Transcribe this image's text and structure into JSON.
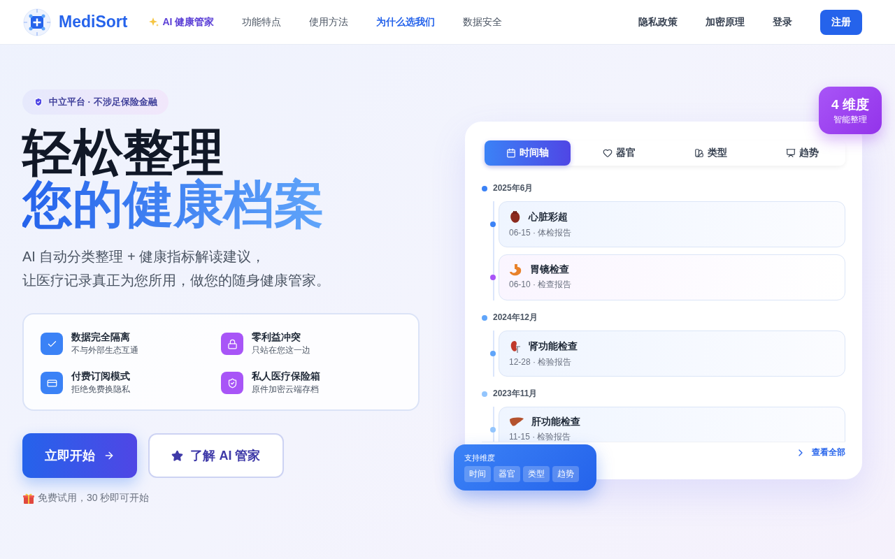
{
  "nav": {
    "brand": "MediSort",
    "links": [
      {
        "label": "AI 健康管家",
        "kind": "ai",
        "selected": false
      },
      {
        "label": "功能特点",
        "kind": "plain",
        "selected": false
      },
      {
        "label": "使用方法",
        "kind": "plain",
        "selected": false
      },
      {
        "label": "为什么选我们",
        "kind": "plain",
        "selected": true
      },
      {
        "label": "数据安全",
        "kind": "plain",
        "selected": false
      }
    ],
    "right_links": [
      "隐私政策",
      "加密原理",
      "登录"
    ],
    "signup": "注册"
  },
  "hero": {
    "badge": "中立平台 · 不涉足保险金融",
    "title_line_1": "轻松整理",
    "title_line_2": "您的健康档案",
    "subtitle_lines": [
      "AI 自动分类整理 + 健康指标解读建议，",
      "让医疗记录真正为您所用，做您的随身健康管家。"
    ],
    "features": [
      {
        "color": "#3b82f6",
        "title": "数据完全隔离",
        "text": "不与外部生态互通"
      },
      {
        "color": "#a855f7",
        "title": "零利益冲突",
        "text": "只站在您这一边"
      },
      {
        "color": "#3b82f6",
        "title": "付费订阅模式",
        "text": "拒绝免费换隐私"
      },
      {
        "color": "#a855f7",
        "title": "私人医疗保险箱",
        "text": "原件加密云端存档"
      }
    ],
    "primary_button": "立即开始",
    "secondary_button": "了解 AI 管家",
    "note": "免费试用，30 秒即可开始"
  },
  "preview": {
    "tabs": [
      {
        "label": "时间轴",
        "selected": true
      },
      {
        "label": "器官",
        "selected": false
      },
      {
        "label": "类型",
        "selected": false
      },
      {
        "label": "趋势",
        "selected": false
      }
    ],
    "corner_badge": {
      "value": "4 维度",
      "caption": "智能整理"
    },
    "groups": [
      {
        "month": "2025年6月",
        "color": "#3b82f6",
        "entries": [
          {
            "kind": "heart",
            "title": "心脏彩超",
            "meta": "06-15 · 体检报告",
            "color": "#3b82f6"
          },
          {
            "kind": "stomach",
            "title": "胃镜检查",
            "meta": "06-10 · 检查报告",
            "color": "#a855f7"
          }
        ]
      },
      {
        "month": "2024年12月",
        "color": "#60a5fa",
        "entries": [
          {
            "kind": "kidney",
            "title": "肾功能检查",
            "meta": "12-28 · 检验报告",
            "color": "#60a5fa"
          }
        ]
      },
      {
        "month": "2023年11月",
        "color": "#93c5fd",
        "entries": [
          {
            "kind": "liver",
            "title": "肝功能检查",
            "meta": "11-15 · 检验报告",
            "color": "#93c5fd"
          }
        ]
      }
    ],
    "view_all": "查看全部",
    "dimensions": {
      "title": "支持维度",
      "tags": [
        "时间",
        "器官",
        "类型",
        "趋势"
      ]
    }
  }
}
